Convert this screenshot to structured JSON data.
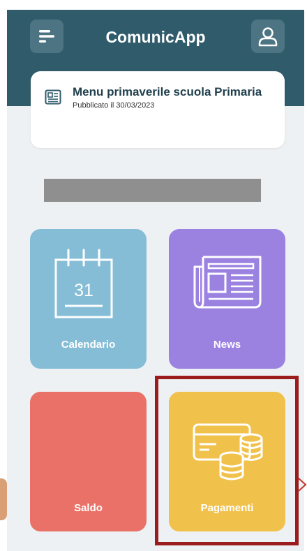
{
  "header": {
    "title": "ComunicApp",
    "menu_icon": "menu-icon",
    "user_icon": "user-icon",
    "color": "#2f5b6b"
  },
  "notice": {
    "title": "Menu primaverile scuola Primaria",
    "date": "Pubblicato il 30/03/2023",
    "icon": "newspaper-icon"
  },
  "tiles": [
    {
      "label": "Calendario",
      "icon": "calendar-icon",
      "day": "31",
      "color": "#86bdd6"
    },
    {
      "label": "News",
      "icon": "newspaper-icon",
      "color": "#9b82e1"
    },
    {
      "label": "Saldo",
      "color": "#ea7167"
    },
    {
      "label": "Pagamenti",
      "icon": "card-coins-icon",
      "color": "#f0c14b"
    }
  ],
  "highlight_color": "#9b1c1c"
}
